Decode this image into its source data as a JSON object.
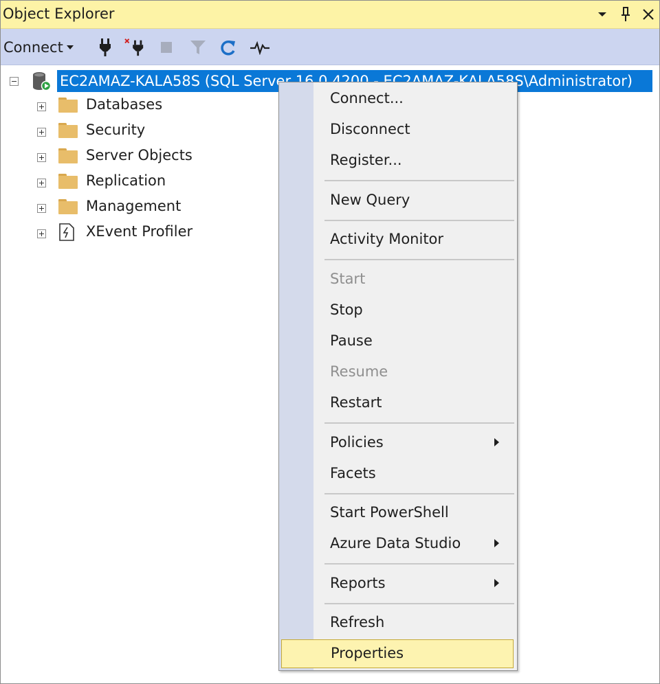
{
  "panel": {
    "title": "Object Explorer",
    "title_icons": [
      "dropdown-caret-icon",
      "pin-icon",
      "close-icon"
    ]
  },
  "toolbar": {
    "connect_label": "Connect",
    "icons": [
      "connect-plug-icon",
      "disconnect-plug-icon",
      "stop-icon",
      "filter-icon",
      "refresh-icon",
      "activity-pulse-icon"
    ]
  },
  "tree": {
    "server": {
      "label": "EC2AMAZ-KALA58S (SQL Server 16.0.4200 - EC2AMAZ-KALA58S\\Administrator)",
      "icon": "database-server-icon",
      "expanded": true
    },
    "children": [
      {
        "label": "Databases",
        "icon": "folder-icon"
      },
      {
        "label": "Security",
        "icon": "folder-icon"
      },
      {
        "label": "Server Objects",
        "icon": "folder-icon"
      },
      {
        "label": "Replication",
        "icon": "folder-icon"
      },
      {
        "label": "Management",
        "icon": "folder-icon"
      },
      {
        "label": "XEvent Profiler",
        "icon": "xevent-profiler-icon"
      }
    ]
  },
  "context_menu": {
    "items": [
      {
        "label": "Connect..."
      },
      {
        "label": "Disconnect"
      },
      {
        "label": "Register..."
      },
      {
        "label": "New Query"
      },
      {
        "label": "Activity Monitor"
      },
      {
        "label": "Start",
        "disabled": true
      },
      {
        "label": "Stop"
      },
      {
        "label": "Pause"
      },
      {
        "label": "Resume",
        "disabled": true
      },
      {
        "label": "Restart"
      },
      {
        "label": "Policies",
        "submenu": true
      },
      {
        "label": "Facets"
      },
      {
        "label": "Start PowerShell"
      },
      {
        "label": "Azure Data Studio",
        "submenu": true
      },
      {
        "label": "Reports",
        "submenu": true
      },
      {
        "label": "Refresh"
      },
      {
        "label": "Properties",
        "highlighted": true
      }
    ]
  },
  "colors": {
    "title_bg": "#fdf3a6",
    "toolbar_bg": "#ccd5f0",
    "selection": "#0a78d7",
    "menu_bg": "#f0f0f0",
    "menu_gutter": "#d4daeb",
    "menu_hover": "#fdf3b0",
    "disabled_text": "#8f8f8f"
  }
}
